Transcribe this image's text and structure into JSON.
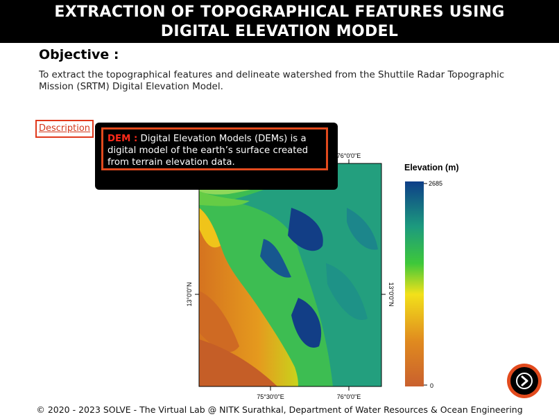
{
  "header": {
    "title_line1": "EXTRACTION OF TOPOGRAPHICAL FEATURES USING",
    "title_line2": "DIGITAL ELEVATION MODEL"
  },
  "objective": {
    "heading": "Objective :",
    "text": "To extract the topographical features and delineate watershed from the Shuttile Radar Topographic Mission (SRTM) Digital Elevation Model."
  },
  "description_link": "Description",
  "tooltip": {
    "term": "DEM :",
    "text": " Digital Elevation Models (DEMs) is a digital model of the earth’s surface created from terrain elevation data."
  },
  "map": {
    "legend_title": "Elevation (m)",
    "legend_max": "2685",
    "legend_min": "0",
    "top_tick": "76°0'0\"E",
    "bottom_ticks": [
      "75°30'0\"E",
      "76°0'0\"E"
    ],
    "left_tick": "13°0'0\"N",
    "right_tick": "13°0'0\"N"
  },
  "footer": "© 2020 - 2023 SOLVE - The Virtual Lab @ NITK Surathkal, Department of Water Resources & Ocean Engineering",
  "colors": {
    "accent": "#e24a1d",
    "header_bg": "#000000"
  },
  "icons": {
    "next": "arrow-right-icon"
  }
}
